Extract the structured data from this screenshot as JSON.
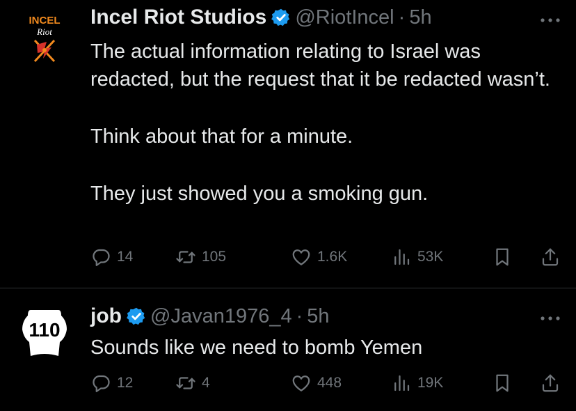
{
  "tweets": [
    {
      "name": "Incel Riot Studios",
      "handle": "@RiotIncel",
      "time": "5h",
      "verified": true,
      "avatar": {
        "line1": "INCEL",
        "line2": "Riot"
      },
      "paragraphs": [
        "The actual information relating to Israel was redacted, but the request that it be redacted wasn’t.",
        "Think about that for a minute.",
        "They just showed you a smoking gun."
      ],
      "stats": {
        "replies": "14",
        "retweets": "105",
        "likes": "1.6K",
        "views": "53K"
      }
    },
    {
      "name": "job",
      "handle": "@Javan1976_4",
      "time": "5h",
      "verified": true,
      "avatar": {
        "label": "110"
      },
      "paragraphs": [
        "Sounds like we need to bomb Yemen"
      ],
      "stats": {
        "replies": "12",
        "retweets": "4",
        "likes": "448",
        "views": "19K"
      }
    }
  ],
  "colors": {
    "background": "#000000",
    "text": "#e7e9ea",
    "muted": "#71767b",
    "verified": "#1d9bf0",
    "avatar1_orange": "#f28a1e",
    "avatar1_red": "#d6322a"
  },
  "icons": [
    "more-icon",
    "verified-icon",
    "reply-icon",
    "retweet-icon",
    "like-icon",
    "views-icon",
    "bookmark-icon",
    "share-icon"
  ]
}
